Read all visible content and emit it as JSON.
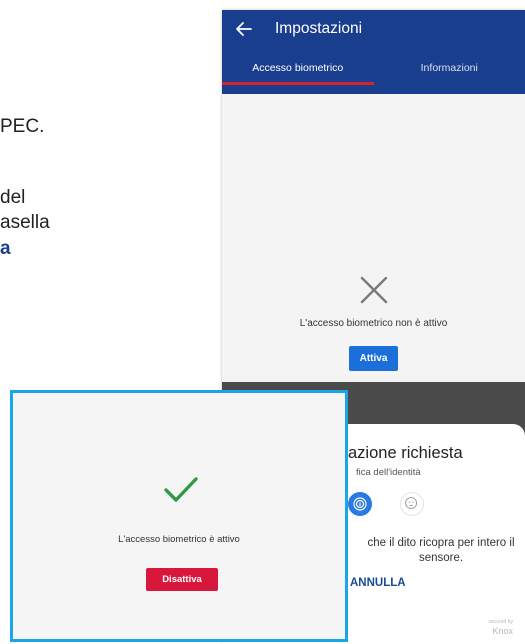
{
  "document": {
    "lines": [
      "PEC.",
      "del",
      "asella",
      "a"
    ]
  },
  "app": {
    "title": "Impostazioni",
    "tabs": [
      {
        "label": "Accesso biometrico",
        "active": true
      },
      {
        "label": "Informazioni",
        "active": false
      }
    ],
    "status_text": "L'accesso biometrico non è attivo",
    "activate_label": "Attiva",
    "accent_color": "#1a3e8e",
    "tab_indicator_color": "#d8232a"
  },
  "biometric_dialog": {
    "title": "azione richiesta",
    "subtitle": "fica dell'identità",
    "instruction": "che il dito ricopra per intero il sensore.",
    "cancel_label": "ANNULLA",
    "knox_small": "secured by",
    "knox_label": "Knox"
  },
  "inset_screen": {
    "status_text": "L'accesso biometrico è attivo",
    "deactivate_label": "Disattiva",
    "border_color": "#1aa5e6"
  }
}
